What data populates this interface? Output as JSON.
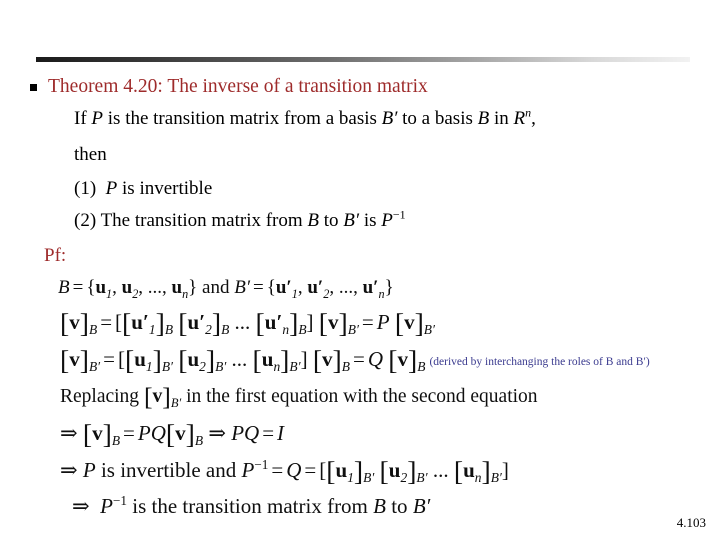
{
  "slide": {
    "background_color": "#ffffff",
    "accent_red": "#9E2B2B",
    "annotation_blue": "#3B3B8F",
    "number": "4.103"
  },
  "heading": {
    "bullet": "square-bullet",
    "text": "Theorem 4.20: The inverse of a transition matrix"
  },
  "statement": {
    "line1_a": "If ",
    "line1_P": "P",
    "line1_b": " is the transition matrix from a basis ",
    "line1_Bp": "B′",
    "line1_c": " to a basis ",
    "line1_B": "B",
    "line1_d": " in ",
    "line1_R": "R",
    "line1_n": "n",
    "line1_e": ",",
    "line2": "then",
    "item1_num": "(1)",
    "item1_P": "P",
    "item1_text": " is invertible",
    "item2_num": "(2)",
    "item2_text_a": " The transition matrix from ",
    "item2_B": "B",
    "item2_text_b": " to ",
    "item2_Bp": "B′",
    "item2_text_c": " is ",
    "item2_P": "P",
    "item2_exp": "−1"
  },
  "proof": {
    "label": "Pf:",
    "eq1": {
      "B": "B",
      "eq": "=",
      "open": "{",
      "u1": "u",
      "s1": "1",
      "u2": "u",
      "s2": "2",
      "dots": "...,",
      "un": "u",
      "sn": "n",
      "close": "}",
      "and": "and",
      "Bp": "B′",
      "eq2": "=",
      "open2": "{",
      "pu1": "u′",
      "ps1": "1",
      "pu2": "u′",
      "ps2": "2",
      "pdots": "...,",
      "pun": "u′",
      "psn": "n",
      "close2": "}"
    },
    "eq2": {
      "lhs_v": "v",
      "lhs_sub": "B",
      "eq": "=",
      "c1_u": "u′",
      "c1_i": "1",
      "c1_sub": "B",
      "c2_u": "u′",
      "c2_i": "2",
      "c2_sub": "B",
      "dots": "...",
      "cn_u": "u′",
      "cn_i": "n",
      "cn_sub": "B",
      "v2": "v",
      "v2_sub": "B′",
      "eq2": "=",
      "P": "P",
      "v3": "v",
      "v3_sub": "B′"
    },
    "eq3": {
      "lhs_v": "v",
      "lhs_sub": "B′",
      "eq": "=",
      "c1_u": "u",
      "c1_i": "1",
      "c1_sub": "B′",
      "c2_u": "u",
      "c2_i": "2",
      "c2_sub": "B′",
      "dots": "...",
      "cn_u": "u",
      "cn_i": "n",
      "cn_sub": "B′",
      "v2": "v",
      "v2_sub": "B",
      "eq2": "=",
      "Q": "Q",
      "v3": "v",
      "v3_sub": "B",
      "note": "(derived by interchanging the roles of B and B′)"
    },
    "eq4": {
      "text_a": "Replacing ",
      "v": "v",
      "v_sub": "B′",
      "text_b": " in the first equation with the second equation"
    },
    "eq5": {
      "arrow": "⇒",
      "v1": "v",
      "v1_sub": "B",
      "eq": "=",
      "PQ": "PQ",
      "v2": "v",
      "v2_sub": "B",
      "arrow2": "⇒",
      "PQ2": "PQ",
      "eq2": "=",
      "I": "I"
    },
    "eq6": {
      "arrow": "⇒",
      "P": "P",
      "text_a": " is invertible and ",
      "P2": "P",
      "P2_exp": "−1",
      "eq": "=",
      "Q": "Q",
      "eq2": "=",
      "c1_u": "u",
      "c1_i": "1",
      "c1_sub": "B′",
      "c2_u": "u",
      "c2_i": "2",
      "c2_sub": "B′",
      "dots": "...",
      "cn_u": "u",
      "cn_i": "n",
      "cn_sub": "B′"
    },
    "eq7": {
      "arrow": "⇒",
      "P": "P",
      "P_exp": "−1",
      "text_a": " is the transition matrix from ",
      "B": "B",
      "text_b": " to ",
      "Bp": "B′"
    }
  }
}
